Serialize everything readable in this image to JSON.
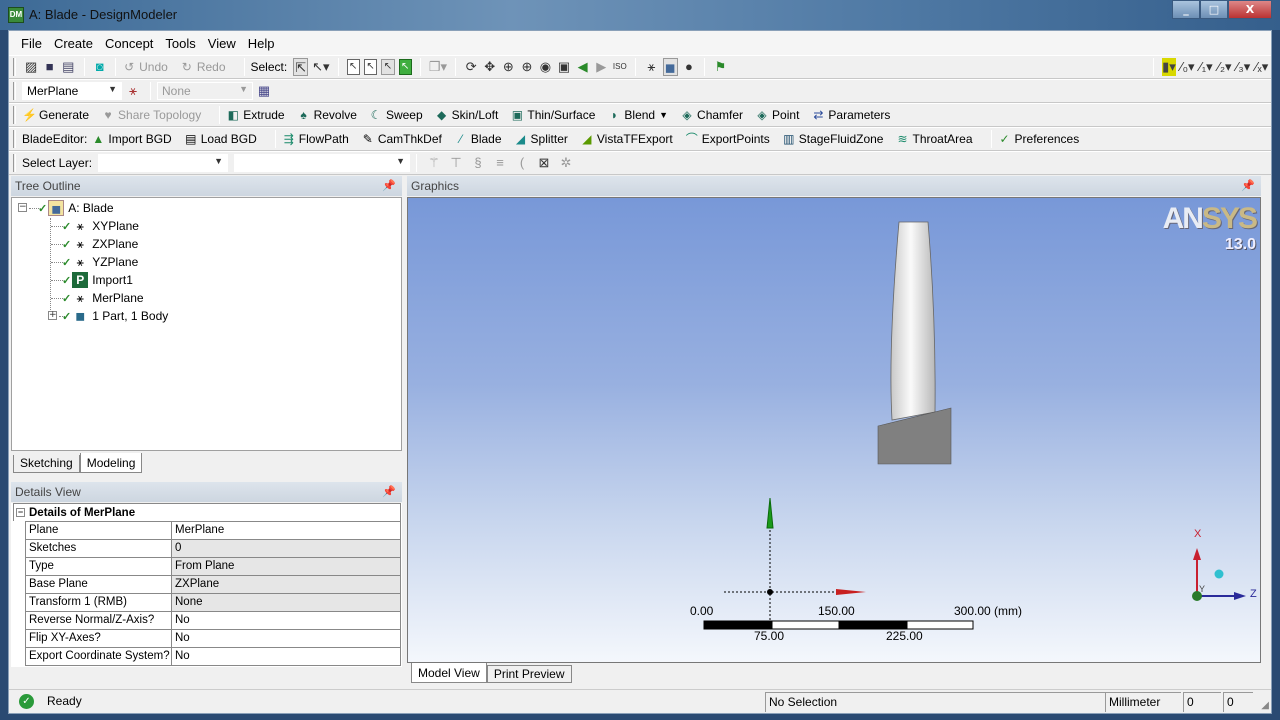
{
  "window": {
    "title": "A: Blade - DesignModeler",
    "app_icon": "DM",
    "minimize": "_",
    "maximize": "□",
    "close": "X"
  },
  "menu": [
    "File",
    "Create",
    "Concept",
    "Tools",
    "View",
    "Help"
  ],
  "toolbar1": {
    "undo": "Undo",
    "redo": "Redo",
    "select_label": "Select:"
  },
  "toolbar2": {
    "plane": "MerPlane",
    "sketch": "None"
  },
  "toolbar3": {
    "generate": "Generate",
    "share_topology": "Share Topology",
    "extrude": "Extrude",
    "revolve": "Revolve",
    "sweep": "Sweep",
    "skin_loft": "Skin/Loft",
    "thin_surface": "Thin/Surface",
    "blend": "Blend",
    "chamfer": "Chamfer",
    "point": "Point",
    "parameters": "Parameters"
  },
  "toolbar4": {
    "label": "BladeEditor:",
    "import_bgd": "Import BGD",
    "load_bgd": "Load BGD",
    "flowpath": "FlowPath",
    "camthkdef": "CamThkDef",
    "blade": "Blade",
    "splitter": "Splitter",
    "vistatfexport": "VistaTFExport",
    "exportpoints": "ExportPoints",
    "stagefluidzone": "StageFluidZone",
    "throatarea": "ThroatArea",
    "preferences": "Preferences"
  },
  "toolbar5": {
    "select_layer": "Select Layer:",
    "layer_value": "",
    "second_value": ""
  },
  "tree": {
    "header": "Tree Outline",
    "root": "A: Blade",
    "children": [
      "XYPlane",
      "ZXPlane",
      "YZPlane",
      "Import1",
      "MerPlane",
      "1 Part, 1 Body"
    ]
  },
  "left_tabs": {
    "sketching": "Sketching",
    "modeling": "Modeling"
  },
  "details": {
    "header": "Details View",
    "title": "Details of MerPlane",
    "rows": [
      {
        "key": "Plane",
        "value": "MerPlane",
        "readonly": false
      },
      {
        "key": "Sketches",
        "value": "0",
        "readonly": true
      },
      {
        "key": "Type",
        "value": "From Plane",
        "readonly": true
      },
      {
        "key": "Base Plane",
        "value": "ZXPlane",
        "readonly": true
      },
      {
        "key": "Transform 1 (RMB)",
        "value": "None",
        "readonly": true
      },
      {
        "key": "Reverse Normal/Z-Axis?",
        "value": "No",
        "readonly": false
      },
      {
        "key": "Flip XY-Axes?",
        "value": "No",
        "readonly": false
      },
      {
        "key": "Export Coordinate System?",
        "value": "No",
        "readonly": false
      }
    ]
  },
  "graphics": {
    "header": "Graphics",
    "logo_a": "AN",
    "logo_b": "SYS",
    "version": "13.0",
    "scale": {
      "l0": "0.00",
      "l1": "75.00",
      "l2": "150.00",
      "l3": "225.00",
      "l4": "300.00 (mm)"
    },
    "triad": {
      "x": "X",
      "y": "Y",
      "z": "Z"
    },
    "tabs": {
      "model_view": "Model View",
      "print_preview": "Print Preview"
    }
  },
  "status": {
    "ready": "Ready",
    "selection": "No Selection",
    "units": "Millimeter",
    "v1": "0",
    "v2": "0"
  }
}
